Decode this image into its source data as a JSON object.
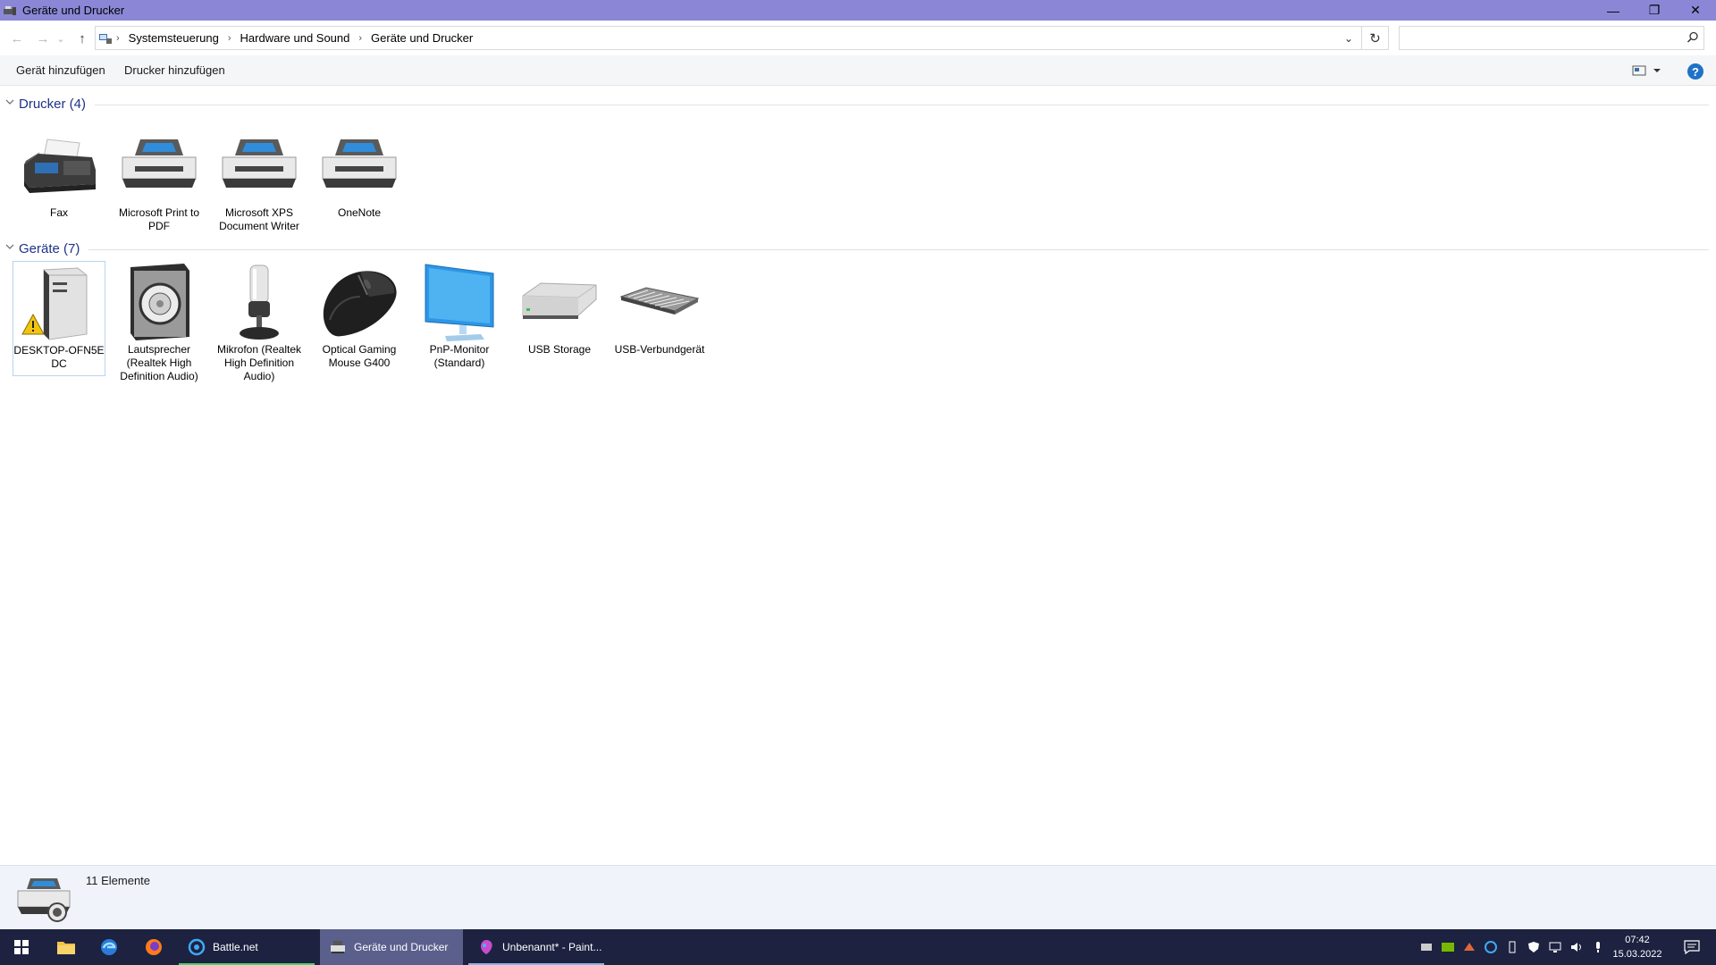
{
  "window": {
    "title": "Geräte und Drucker",
    "controls": {
      "minimize": "—",
      "restore": "❐",
      "close": "✕"
    }
  },
  "address": {
    "back": "←",
    "forward": "→",
    "recent": "⌄",
    "up": "↑",
    "separator": "›",
    "breadcrumbs": [
      "Systemsteuerung",
      "Hardware und Sound",
      "Geräte und Drucker"
    ],
    "dropdown": "⌄",
    "refresh": "↻",
    "search_placeholder": ""
  },
  "commands": {
    "add_device": "Gerät hinzufügen",
    "add_printer": "Drucker hinzufügen",
    "help": "?"
  },
  "groups": {
    "printers": {
      "title": "Drucker (4)",
      "items": [
        {
          "label": "Fax",
          "icon": "fax-icon"
        },
        {
          "label": "Microsoft Print to PDF",
          "icon": "printer-icon"
        },
        {
          "label": "Microsoft XPS Document Writer",
          "icon": "printer-icon"
        },
        {
          "label": "OneNote",
          "icon": "printer-icon"
        }
      ]
    },
    "devices": {
      "title": "Geräte (7)",
      "items": [
        {
          "label": "DESKTOP-OFN5E DC",
          "icon": "computer-warning-icon"
        },
        {
          "label": "Lautsprecher (Realtek High Definition Audio)",
          "icon": "speaker-icon"
        },
        {
          "label": "Mikrofon (Realtek High Definition Audio)",
          "icon": "microphone-icon"
        },
        {
          "label": "Optical Gaming Mouse G400",
          "icon": "mouse-icon"
        },
        {
          "label": "PnP-Monitor (Standard)",
          "icon": "monitor-icon"
        },
        {
          "label": "USB Storage",
          "icon": "usb-storage-icon"
        },
        {
          "label": "USB-Verbundgerät",
          "icon": "keyboard-icon"
        }
      ]
    }
  },
  "details": {
    "count": "11 Elemente"
  },
  "taskbar": {
    "apps": [
      {
        "label": "Battle.net"
      },
      {
        "label": "Geräte und Drucker"
      },
      {
        "label": "Unbenannt* - Paint..."
      }
    ],
    "clock": {
      "time": "07:42",
      "date": "15.03.2022"
    }
  },
  "colors": {
    "titlebar": "#8b87d6",
    "group_header": "#1e3287",
    "taskbar": "#1c2240",
    "accent": "#1e72c8"
  }
}
